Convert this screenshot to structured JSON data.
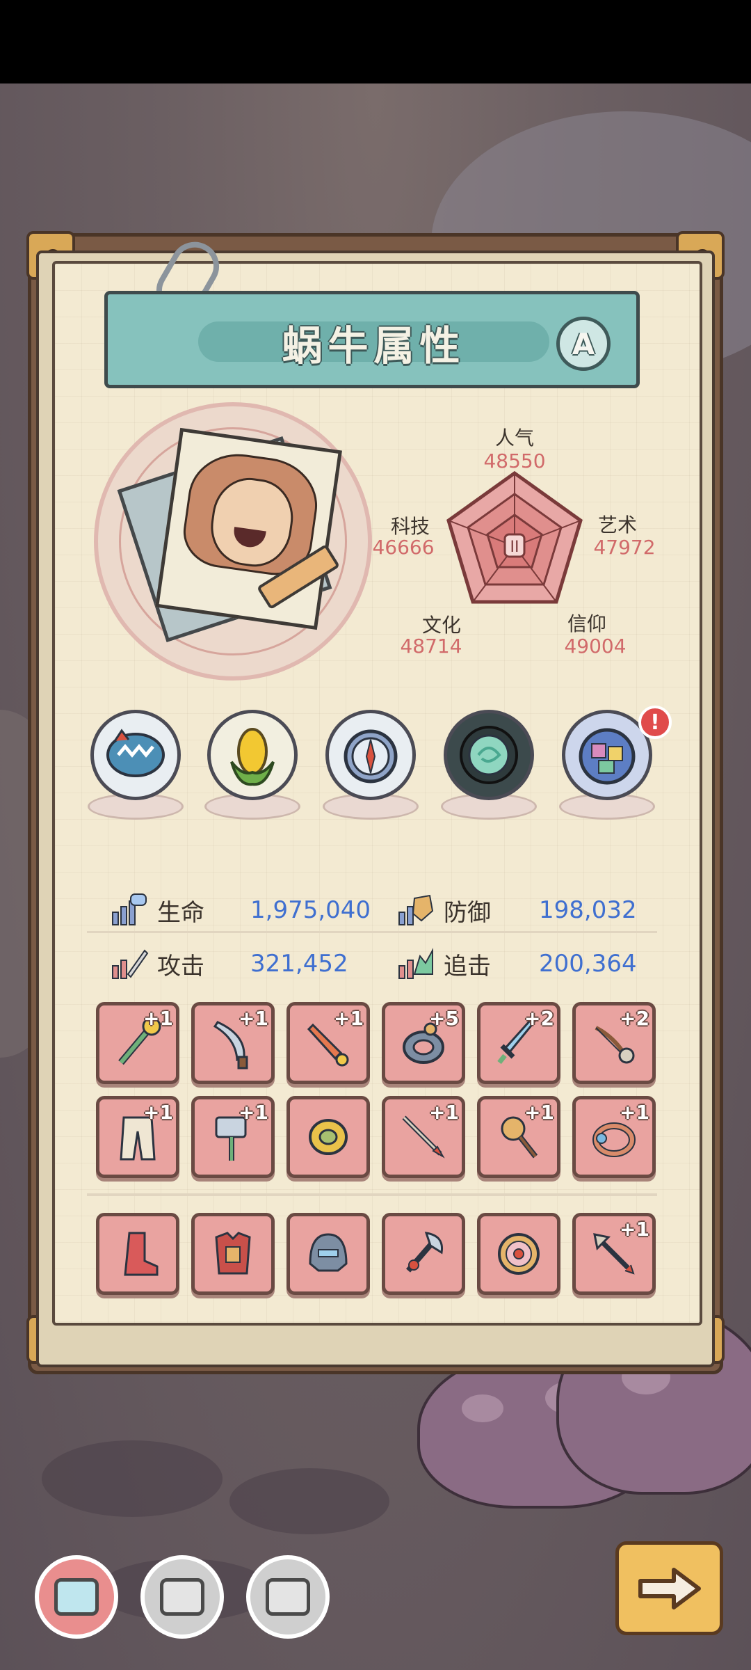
{
  "screen": {
    "title": "蜗牛属性",
    "grade": "A"
  },
  "radar": {
    "axes": [
      {
        "label": "人气",
        "value": "48550"
      },
      {
        "label": "艺术",
        "value": "47972"
      },
      {
        "label": "信仰",
        "value": "49004"
      },
      {
        "label": "文化",
        "value": "48714"
      },
      {
        "label": "科技",
        "value": "46666"
      }
    ],
    "center_label": "II"
  },
  "relics": [
    {
      "icon": "shark-jaw-icon",
      "alert": ""
    },
    {
      "icon": "corn-icon",
      "alert": ""
    },
    {
      "icon": "compass-icon",
      "alert": ""
    },
    {
      "icon": "portal-icon",
      "alert": ""
    },
    {
      "icon": "gems-plate-icon",
      "alert": "!"
    }
  ],
  "stats": {
    "hp": {
      "label": "生命",
      "value": "1,975,040"
    },
    "def": {
      "label": "防御",
      "value": "198,032"
    },
    "atk": {
      "label": "攻击",
      "value": "321,452"
    },
    "chase": {
      "label": "追击",
      "value": "200,364"
    }
  },
  "equipment": [
    {
      "icon": "dragon-staff-icon",
      "level": "+1"
    },
    {
      "icon": "curved-knife-icon",
      "level": "+1"
    },
    {
      "icon": "rocket-dagger-icon",
      "level": "+1"
    },
    {
      "icon": "bracer-icon",
      "level": "+5"
    },
    {
      "icon": "sword-icon",
      "level": "+2"
    },
    {
      "icon": "bow-icon",
      "level": "+2"
    },
    {
      "icon": "pants-icon",
      "level": "+1"
    },
    {
      "icon": "war-hammer-icon",
      "level": "+1"
    },
    {
      "icon": "golden-armor-icon",
      "level": ""
    },
    {
      "icon": "spear-icon",
      "level": "+1"
    },
    {
      "icon": "mace-icon",
      "level": "+1"
    },
    {
      "icon": "ring-icon",
      "level": "+1"
    },
    {
      "icon": "boot-icon",
      "level": ""
    },
    {
      "icon": "chest-armor-icon",
      "level": ""
    },
    {
      "icon": "helmet-icon",
      "level": ""
    },
    {
      "icon": "axe-icon",
      "level": ""
    },
    {
      "icon": "flower-shield-icon",
      "level": ""
    },
    {
      "icon": "arrow-spear-icon",
      "level": "+1"
    }
  ],
  "nav": [
    {
      "icon": "tv-screen-icon",
      "active": true
    },
    {
      "icon": "tv-screen-icon",
      "active": false
    },
    {
      "icon": "tv-screen-icon",
      "active": false
    }
  ],
  "colors": {
    "accent_teal": "#86c2bd",
    "stat_blue": "#3f6fd0",
    "radar_red": "#d16a6a",
    "slot_pink": "#e9a3a0"
  }
}
